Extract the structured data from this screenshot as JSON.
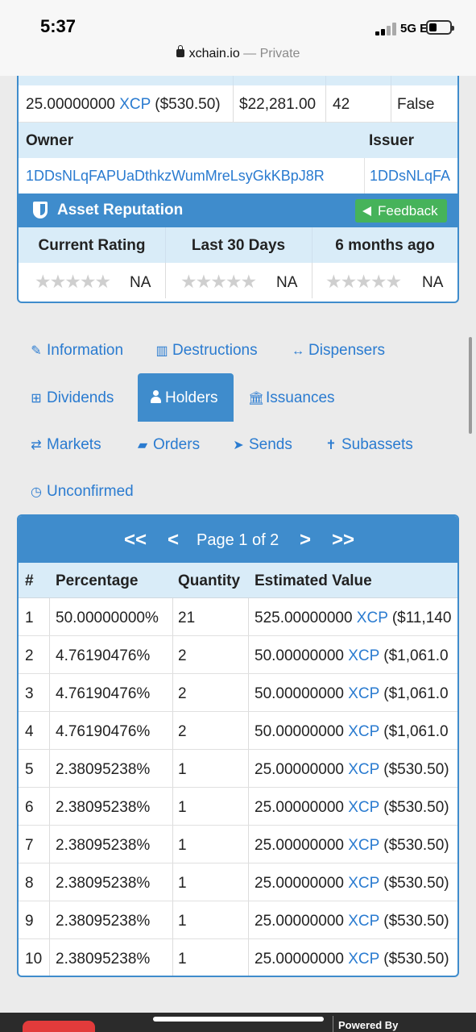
{
  "status_bar": {
    "time": "5:37",
    "network": "5G E"
  },
  "browser": {
    "domain": "xchain.io",
    "private_label": "— Private"
  },
  "asset_row": {
    "supply_amount": "25.00000000",
    "supply_asset": "XCP",
    "supply_usd": "($530.50)",
    "market_value": "$22,281.00",
    "holders_count": "42",
    "locked": "False"
  },
  "owner_issuer": {
    "owner_label": "Owner",
    "issuer_label": "Issuer",
    "owner_address": "1DDsNLqFAPUaDthkzWumMreLsyGkKBpJ8R",
    "issuer_address": "1DDsNLqFA"
  },
  "reputation": {
    "title": "Asset Reputation",
    "feedback_label": "Feedback",
    "columns": [
      "Current Rating",
      "Last 30 Days",
      "6 months ago"
    ],
    "values": [
      "NA",
      "NA",
      "NA"
    ],
    "stars": "★★★★★"
  },
  "tabs": {
    "information": "Information",
    "destructions": "Destructions",
    "dispensers": "Dispensers",
    "dividends": "Dividends",
    "holders": "Holders",
    "issuances": "Issuances",
    "markets": "Markets",
    "orders": "Orders",
    "sends": "Sends",
    "subassets": "Subassets",
    "unconfirmed": "Unconfirmed"
  },
  "pager": {
    "first": "<<",
    "prev": "<",
    "label": "Page 1 of 2",
    "next": ">",
    "last": ">>"
  },
  "holders_table": {
    "headers": {
      "num": "#",
      "percentage": "Percentage",
      "quantity": "Quantity",
      "value": "Estimated Value"
    },
    "rows": [
      {
        "n": "1",
        "pct": "50.00000000%",
        "qty": "21",
        "amt": "525.00000000",
        "asset": "XCP",
        "usd": "($11,140"
      },
      {
        "n": "2",
        "pct": "4.76190476%",
        "qty": "2",
        "amt": "50.00000000",
        "asset": "XCP",
        "usd": "($1,061.0"
      },
      {
        "n": "3",
        "pct": "4.76190476%",
        "qty": "2",
        "amt": "50.00000000",
        "asset": "XCP",
        "usd": "($1,061.0"
      },
      {
        "n": "4",
        "pct": "4.76190476%",
        "qty": "2",
        "amt": "50.00000000",
        "asset": "XCP",
        "usd": "($1,061.0"
      },
      {
        "n": "5",
        "pct": "2.38095238%",
        "qty": "1",
        "amt": "25.00000000",
        "asset": "XCP",
        "usd": "($530.50)"
      },
      {
        "n": "6",
        "pct": "2.38095238%",
        "qty": "1",
        "amt": "25.00000000",
        "asset": "XCP",
        "usd": "($530.50)"
      },
      {
        "n": "7",
        "pct": "2.38095238%",
        "qty": "1",
        "amt": "25.00000000",
        "asset": "XCP",
        "usd": "($530.50)"
      },
      {
        "n": "8",
        "pct": "2.38095238%",
        "qty": "1",
        "amt": "25.00000000",
        "asset": "XCP",
        "usd": "($530.50)"
      },
      {
        "n": "9",
        "pct": "2.38095238%",
        "qty": "1",
        "amt": "25.00000000",
        "asset": "XCP",
        "usd": "($530.50)"
      },
      {
        "n": "10",
        "pct": "2.38095238%",
        "qty": "1",
        "amt": "25.00000000",
        "asset": "XCP",
        "usd": "($530.50)"
      }
    ]
  },
  "footer": {
    "powered_by": "Powered By"
  },
  "colors": {
    "accent": "#3f8ccc",
    "link": "#2a7bd0",
    "header_bg": "#d9ecf8",
    "feedback": "#46b35a"
  }
}
